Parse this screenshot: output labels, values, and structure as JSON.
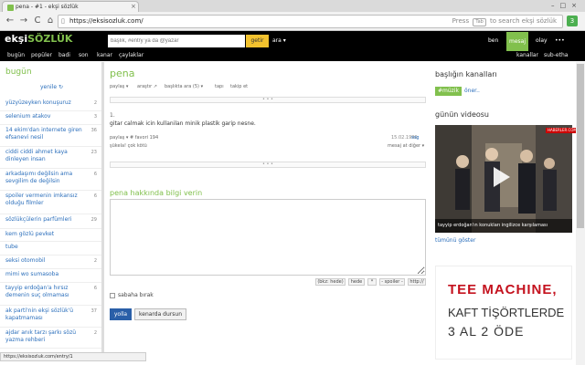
{
  "browser": {
    "tab_title": "pena - #1 - ekşi sözlük",
    "tab_close": "×",
    "win_controls": "–□×",
    "back": "←",
    "forward": "→",
    "reload": "C",
    "home": "⌂",
    "url": "https://eksisozluk.com/",
    "omni_hint_prefix": "Press",
    "omni_hint_key": "Tab",
    "omni_hint_suffix": "to search ekşi sözlük",
    "ext_label": "3"
  },
  "site": {
    "logo_a": "ekşi",
    "logo_b": "SÖZLÜK",
    "search_placeholder": "başlık, #entry ya da @yazar",
    "search_button": "getir",
    "search_mode": "ara",
    "header_links": [
      "ben",
      "mesaj",
      "olay"
    ],
    "top_nav": [
      "bugün",
      "popüler",
      "badi",
      "son",
      "kanar",
      "çaylaklar"
    ],
    "top_nav_right": [
      "kanallar",
      "sub-etha"
    ]
  },
  "left": {
    "title": "bugün",
    "refresh": "yenile ↻",
    "topics": [
      {
        "title": "yüzyüzeyken konuşuruz",
        "count": "2"
      },
      {
        "title": "selenium atakov",
        "count": "3"
      },
      {
        "title": "14 ekim'dan internete giren efsanevi nesil",
        "count": "36"
      },
      {
        "title": "ciddi ciddi ahmet kaya dinleyen insan",
        "count": "23"
      },
      {
        "title": "arkadaşımı değilsin ama sevgilim de değilsin",
        "count": "6"
      },
      {
        "title": "spoiler vermenin imkansız olduğu filmler",
        "count": "6"
      },
      {
        "title": "sözlükçülerin parfümleri",
        "count": "29"
      },
      {
        "title": "kem gözlü pevket",
        "count": ""
      },
      {
        "title": "tube",
        "count": ""
      },
      {
        "title": "seksi otomobil",
        "count": "2"
      },
      {
        "title": "mimi wo sumasoba",
        "count": ""
      },
      {
        "title": "tayyip erdoğan'a hırsız demenin suç olmaması",
        "count": "6"
      },
      {
        "title": "ak parti'nin ekşi sözlük'ü kapatmaması",
        "count": "37"
      },
      {
        "title": "ajdar anık tarzı şarkı sözü yazma rehberi",
        "count": "2"
      }
    ]
  },
  "main": {
    "title": "pena",
    "meta": [
      "paylaş ▾",
      "araştır ↗",
      "başlıkta ara (5) ▾",
      "takip et",
      "takip et"
    ],
    "meta_display": [
      "paylaş ▾",
      "araştır ↗",
      "başlıkta ara (5) ▾",
      "tapı",
      "takip et"
    ],
    "dots": "• • •",
    "entry_num": "1.",
    "entry_text": "gitar calmak icin kullanilan minik plastik garip nesne.",
    "entry_actions": "paylaş ▾  # favori 194",
    "entry_vote": "şükela!  çok kötü",
    "entry_date": "15.02.1999",
    "entry_author": "ssg",
    "entry_right_actions": "mesaj at   diğer ▾",
    "info_label": "pena hakkında bilgi verin",
    "editor_buttons": [
      "(bkz: hede)",
      "hede",
      "*",
      "- spoiler -",
      "http://"
    ],
    "checkbox_label": "sabaha bırak",
    "submit": "yolla",
    "secondary": "kenarda dursun"
  },
  "right": {
    "channels_title": "başlığın kanalları",
    "tag": "#müzik",
    "suggest": "öner..",
    "video_title": "günün videosu",
    "video_brand": "HABERLER.COM",
    "video_caption": "tayyip erdoğan'ın konukları ingilizce karşılaması",
    "see_all": "tümünü göster",
    "ad_line1": "TEE MACHINE,",
    "ad_line2": "KAFT TİŞÖRTLERDE",
    "ad_line3": "3 AL 2 ÖDE"
  },
  "status": "https://eksisozluk.com/entry/1"
}
